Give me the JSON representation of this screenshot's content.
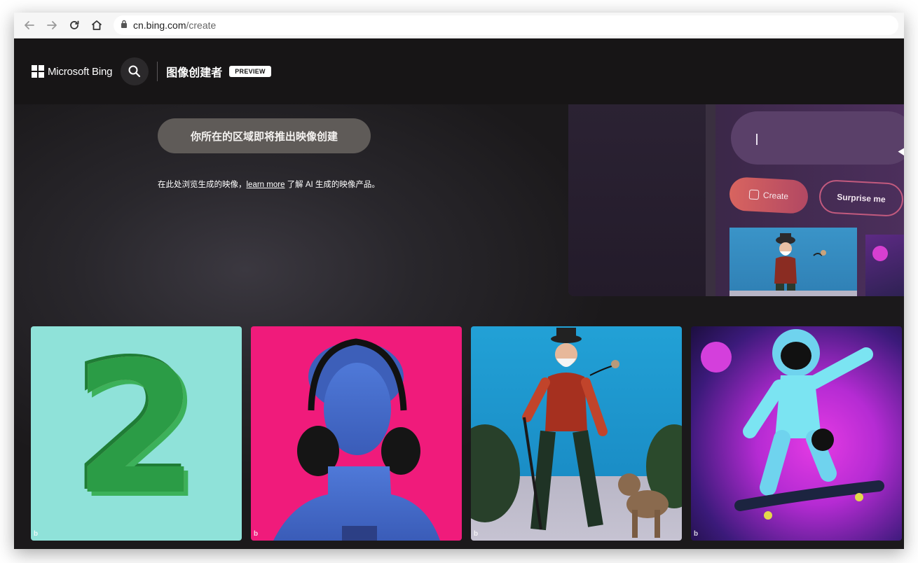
{
  "browser": {
    "url_host": "cn.bing.com",
    "url_path": "/create",
    "icons": [
      "back-arrow-icon",
      "forward-arrow-icon",
      "reload-icon",
      "home-icon",
      "lock-icon"
    ]
  },
  "header": {
    "brand": "Microsoft Bing",
    "product_title": "图像创建者",
    "badge": "PREVIEW"
  },
  "hero": {
    "cta_label": "你所在的区域即将推出映像创建",
    "info_prefix": "在此处浏览生成的映像，",
    "info_link": "learn more",
    "info_suffix": " 了解 AI 生成的映像产品。"
  },
  "preview_panel": {
    "create_label": "Create",
    "surprise_label": "Surprise me"
  },
  "gallery": {
    "tiles": [
      {
        "name": "green-number-two-image",
        "digit": "2"
      },
      {
        "name": "statue-with-headphones-image"
      },
      {
        "name": "old-man-walking-dog-image"
      },
      {
        "name": "astronaut-skateboard-image"
      }
    ],
    "watermark": "b"
  },
  "colors": {
    "page_bg": "#1a1819",
    "cta_bg": "#5f5b58",
    "create_gradient_start": "#d8645f",
    "surprise_border": "#c25a7e"
  }
}
